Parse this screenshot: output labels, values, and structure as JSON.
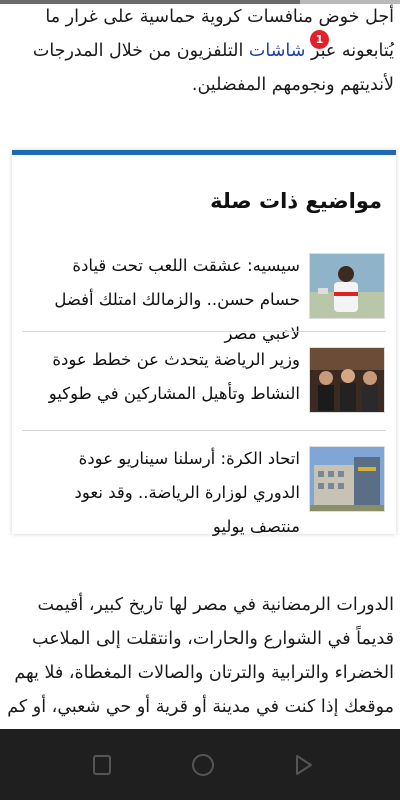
{
  "article": {
    "para1": "أجل خوض منافسات كروية حماسية على غرار ما يُتابعونه عبر",
    "para1_link": "شاشات",
    "para1_rest": "التلفزيون من خلال المدرجات لأنديتهم ونجومهم المفضلين.",
    "para2": "الدورات الرمضانية في مصر لها تاريخ كبير، أقيمت قديماً في الشوارع والحارات، وانتقلت إلى الملاعب الخضراء والترابية والترتان والصالات المغطاة، فلا يهم موقعك إذا كنت في مدينة أو قرية أو حي شعبي، أو كم تملك من"
  },
  "notification": {
    "count": "1"
  },
  "related": {
    "title": "مواضيع ذات صلة",
    "items": [
      {
        "text": "سيسيه: عشقت اللعب تحت قيادة حسام حسن.. والزمالك امتلك أفضل لاعبي مصر"
      },
      {
        "text": "وزير الرياضة يتحدث عن خطط عودة النشاط وتأهيل المشاركين في طوكيو"
      },
      {
        "text": "اتحاد الكرة: أرسلنا سيناريو عودة الدوري لوزارة الرياضة.. وقد نعود منتصف يوليو"
      }
    ]
  },
  "nav": {
    "buttons": [
      "recent-apps-icon",
      "home-icon",
      "back-icon"
    ]
  },
  "colors": {
    "accent": "#1d69b4",
    "link": "#1f3fa8",
    "badge": "#e3202a",
    "navbar": "#1f1f1f"
  }
}
